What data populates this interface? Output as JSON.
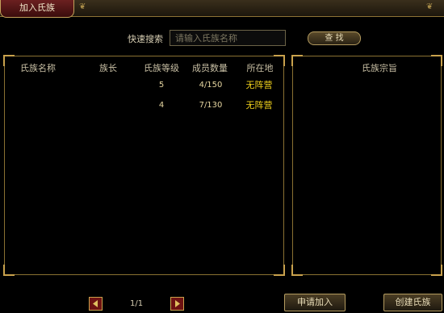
{
  "window": {
    "title": "加入氏族"
  },
  "search": {
    "label": "快速搜索",
    "placeholder": "请输入氏族名称",
    "button_label": "查 找"
  },
  "table": {
    "headers": [
      "氏族名称",
      "族长",
      "氏族等级",
      "成员数量",
      "所在地"
    ],
    "rows": [
      {
        "name": "",
        "leader": "",
        "level": "5",
        "members": "4/150",
        "location": "无阵营"
      },
      {
        "name": "",
        "leader": "",
        "level": "4",
        "members": "7/130",
        "location": "无阵营"
      }
    ]
  },
  "detail": {
    "header": "氏族宗旨"
  },
  "pagination": {
    "page_text": "1/1"
  },
  "actions": {
    "apply_label": "申请加入",
    "create_label": "创建氏族"
  }
}
